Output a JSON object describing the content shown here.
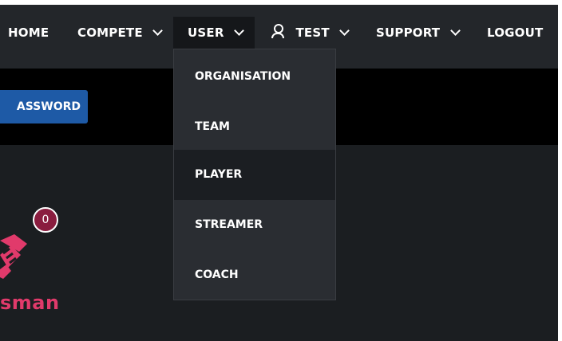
{
  "nav": {
    "home": "HOME",
    "compete": "COMPETE",
    "user": "USER",
    "test": "TEST",
    "support": "SUPPORT",
    "logout": "LOGOUT"
  },
  "dropdown": {
    "items": [
      {
        "label": "ORGANISATION"
      },
      {
        "label": "TEAM"
      },
      {
        "label": "PLAYER"
      },
      {
        "label": "STREAMER"
      },
      {
        "label": "COACH"
      }
    ],
    "hovered": "PLAYER"
  },
  "password_button": {
    "label": "ASSWORD"
  },
  "notification": {
    "count": "0"
  },
  "brand": {
    "text": "sman",
    "color": "#e13a6b"
  },
  "colors": {
    "navbar": "#23262a",
    "band": "#000000",
    "button": "#1e5aa6",
    "badge": "#8a1d3f"
  }
}
